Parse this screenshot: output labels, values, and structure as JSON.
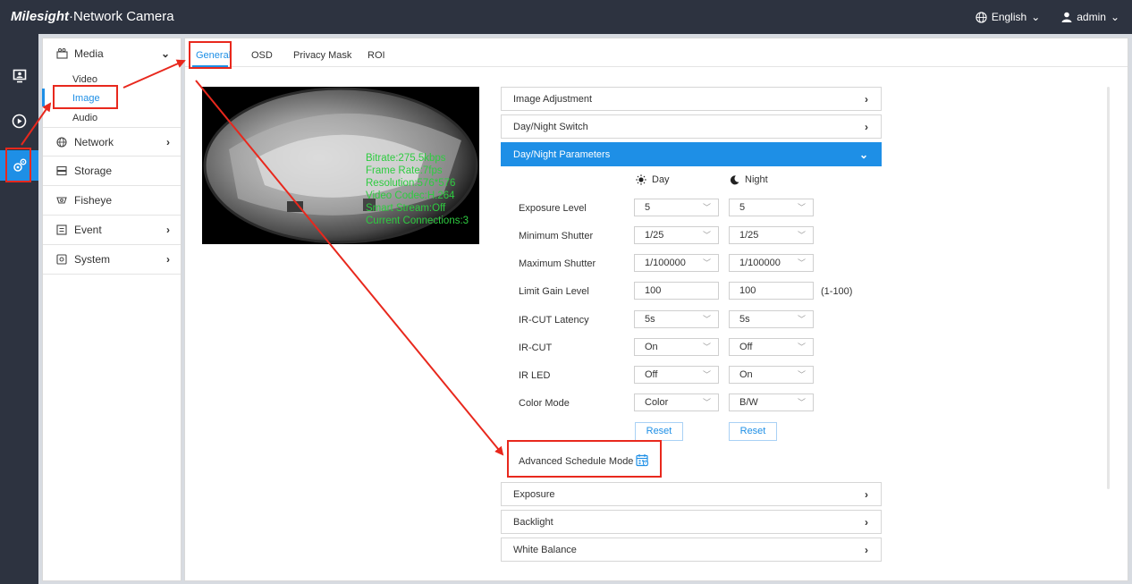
{
  "header": {
    "logo_brand": "Milesight",
    "logo_product": "·Network Camera",
    "language": "English",
    "user": "admin"
  },
  "rail": {
    "items": [
      {
        "icon": "live-view-icon"
      },
      {
        "icon": "playback-icon"
      },
      {
        "icon": "settings-gear-icon",
        "active": true
      }
    ]
  },
  "sidebar": {
    "media": "Media",
    "media_sub": [
      "Video",
      "Image",
      "Audio"
    ],
    "network": "Network",
    "storage": "Storage",
    "fisheye": "Fisheye",
    "event": "Event",
    "system": "System"
  },
  "tabs": [
    "General",
    "OSD",
    "Privacy Mask",
    "ROI"
  ],
  "video_osd": [
    "Bitrate:275.5kbps",
    "Frame Rate:7fps",
    "Resolution:576*576",
    "Video Codec:H.264",
    "Smart Stream:Off",
    "Current Connections:3"
  ],
  "panels": {
    "image_adjustment": "Image Adjustment",
    "day_night_switch": "Day/Night Switch",
    "day_night_parameters": "Day/Night Parameters",
    "exposure": "Exposure",
    "backlight": "Backlight",
    "white_balance": "White Balance"
  },
  "params": {
    "day_label": "Day",
    "night_label": "Night",
    "rows": [
      {
        "label": "Exposure Level",
        "day": "5",
        "night": "5",
        "type": "select"
      },
      {
        "label": "Minimum Shutter",
        "day": "1/25",
        "night": "1/25",
        "type": "select"
      },
      {
        "label": "Maximum Shutter",
        "day": "1/100000",
        "night": "1/100000",
        "type": "select"
      },
      {
        "label": "Limit Gain Level",
        "day": "100",
        "night": "100",
        "type": "input"
      },
      {
        "label": "IR-CUT Latency",
        "day": "5s",
        "night": "5s",
        "type": "select"
      },
      {
        "label": "IR-CUT",
        "day": "On",
        "night": "Off",
        "type": "select"
      },
      {
        "label": "IR LED",
        "day": "Off",
        "night": "On",
        "type": "select"
      },
      {
        "label": "Color Mode",
        "day": "Color",
        "night": "B/W",
        "type": "select"
      }
    ],
    "gain_range": "(1-100)",
    "reset": "Reset",
    "advanced_schedule": "Advanced Schedule Mode"
  },
  "colors": {
    "accent": "#1e8fe6",
    "header_bg": "#2d3340",
    "annotation_red": "#e8281d",
    "osd_green": "#2ecc40"
  }
}
